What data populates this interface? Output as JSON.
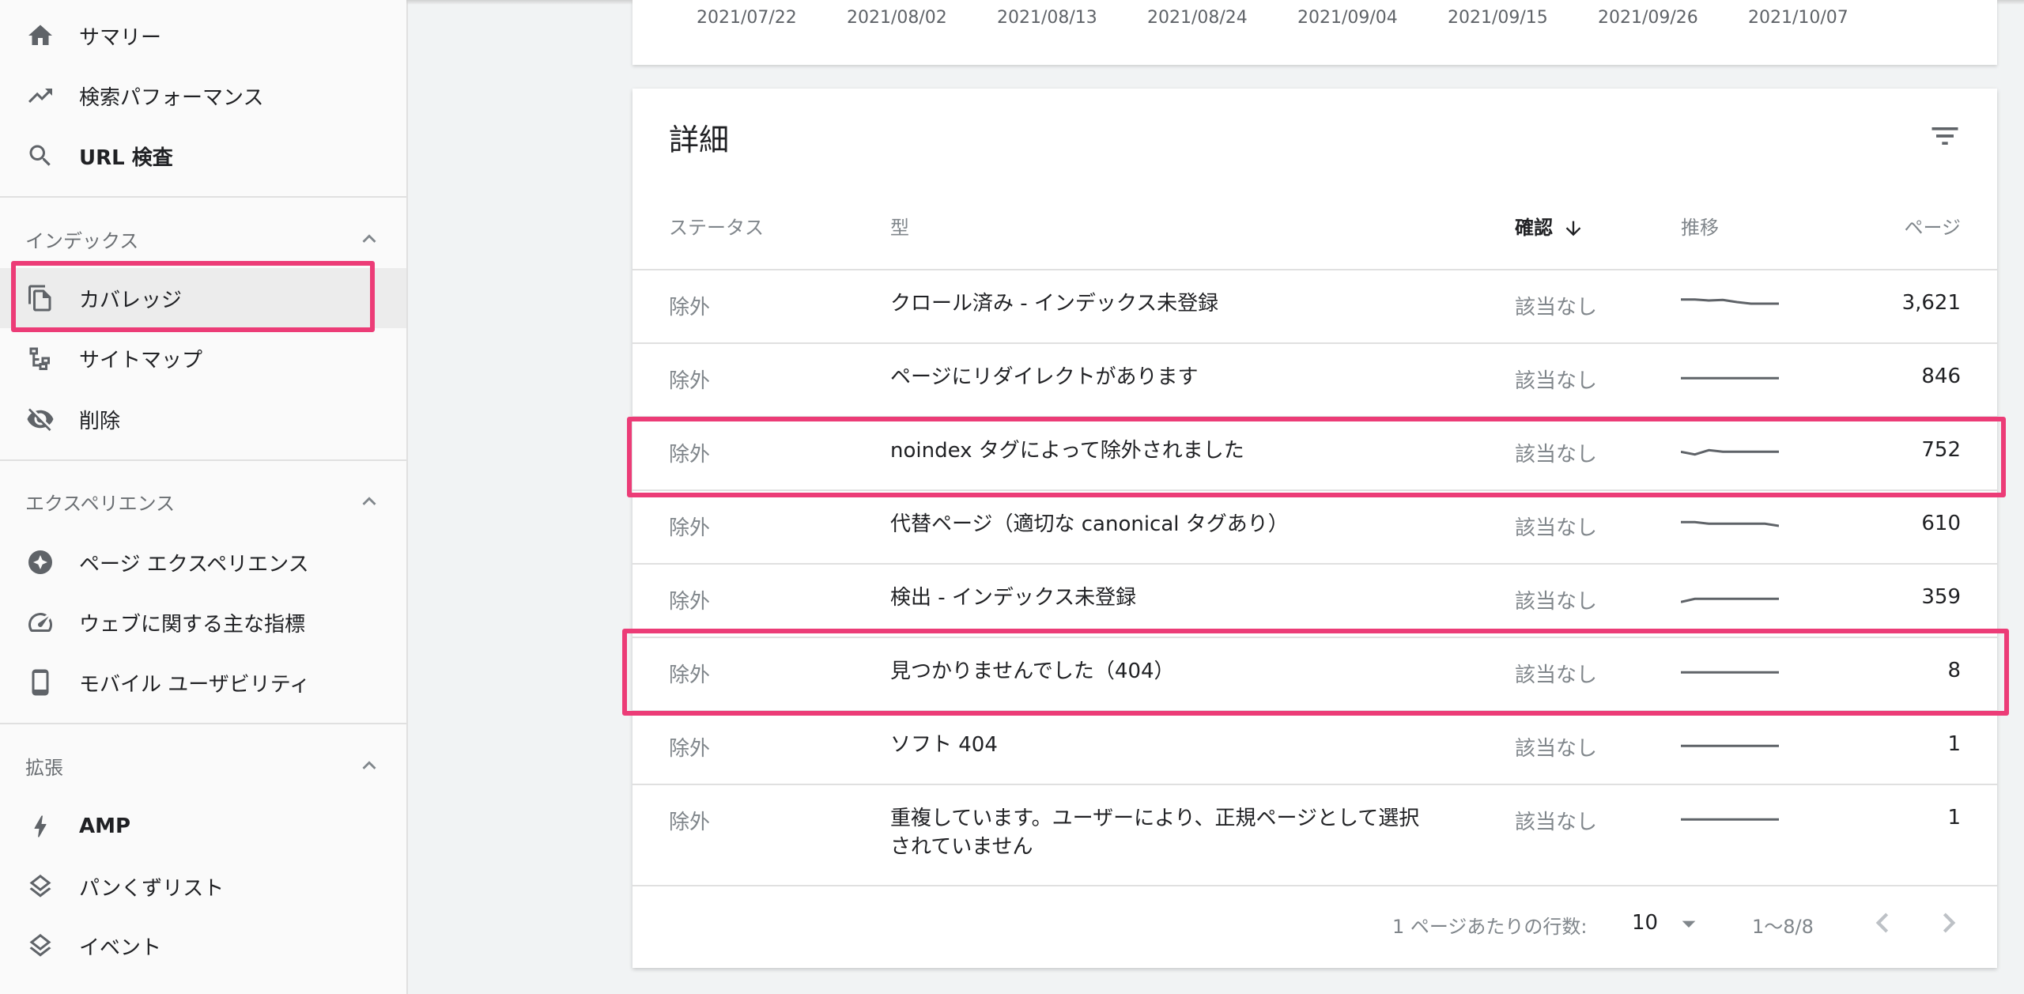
{
  "sidebar": {
    "top_items": [
      {
        "label": "サマリー",
        "icon": "home-icon"
      },
      {
        "label": "検索パフォーマンス",
        "icon": "trending-up-icon"
      },
      {
        "label": "URL 検査",
        "icon": "search-icon"
      }
    ],
    "sections": [
      {
        "label": "インデックス",
        "items": [
          {
            "label": "カバレッジ",
            "icon": "file-copy-icon",
            "active": true
          },
          {
            "label": "サイトマップ",
            "icon": "sitemap-icon"
          },
          {
            "label": "削除",
            "icon": "visibility-off-icon"
          }
        ]
      },
      {
        "label": "エクスペリエンス",
        "items": [
          {
            "label": "ページ エクスペリエンス",
            "icon": "page-experience-icon"
          },
          {
            "label": "ウェブに関する主な指標",
            "icon": "speed-gauge-icon"
          },
          {
            "label": "モバイル ユーザビリティ",
            "icon": "smartphone-icon"
          }
        ]
      },
      {
        "label": "拡張",
        "items": [
          {
            "label": "AMP",
            "icon": "bolt-icon"
          },
          {
            "label": "パンくずリスト",
            "icon": "layers-icon"
          },
          {
            "label": "イベント",
            "icon": "layers-icon"
          }
        ]
      }
    ]
  },
  "chart_axis": {
    "dates": [
      "2021/07/22",
      "2021/08/02",
      "2021/08/13",
      "2021/08/24",
      "2021/09/04",
      "2021/09/15",
      "2021/09/26",
      "2021/10/07"
    ]
  },
  "details": {
    "title": "詳細",
    "columns": {
      "status": "ステータス",
      "type": "型",
      "confirm": "確認",
      "trend": "推移",
      "pages": "ページ"
    },
    "rows": [
      {
        "status": "除外",
        "type": "クロール済み - インデックス未登録",
        "confirm": "該当なし",
        "pages": "3,621",
        "trend": [
          2,
          2,
          1.8,
          1.9,
          1.5,
          1.2,
          1.2,
          1.2
        ]
      },
      {
        "status": "除外",
        "type": "ページにリダイレクトがあります",
        "confirm": "該当なし",
        "pages": "846",
        "trend": [
          1,
          1,
          1,
          1,
          1,
          1,
          1,
          1
        ]
      },
      {
        "status": "除外",
        "type": "noindex タグによって除外されました",
        "confirm": "該当なし",
        "pages": "752",
        "trend": [
          1,
          0.5,
          1.3,
          1,
          1,
          1,
          1,
          1
        ]
      },
      {
        "status": "除外",
        "type": "代替ページ（適切な canonical タグあり）",
        "confirm": "該当なし",
        "pages": "610",
        "trend": [
          1.6,
          1.6,
          1.3,
          1.3,
          1.3,
          1.3,
          1.3,
          0.9
        ]
      },
      {
        "status": "除外",
        "type": "検出 - インデックス未登録",
        "confirm": "該当なし",
        "pages": "359",
        "trend": [
          0.4,
          1,
          1,
          1,
          1,
          1,
          1,
          1
        ]
      },
      {
        "status": "除外",
        "type": "見つかりませんでした（404）",
        "confirm": "該当なし",
        "pages": "8",
        "trend": [
          1,
          1,
          1,
          1,
          1,
          1,
          1,
          1
        ]
      },
      {
        "status": "除外",
        "type": "ソフト 404",
        "confirm": "該当なし",
        "pages": "1",
        "trend": [
          1,
          1,
          1,
          1,
          1,
          1,
          1,
          1
        ]
      },
      {
        "status": "除外",
        "type_line1": "重複しています。ユーザーにより、正規ページとして選択",
        "type_line2": "されていません",
        "confirm": "該当なし",
        "pages": "1",
        "trend": [
          1,
          1,
          1,
          1,
          1,
          1,
          1,
          1
        ]
      }
    ],
    "footer": {
      "rows_per_page_label": "1 ページあたりの行数:",
      "rows_per_page_value": "10",
      "range": "1〜8/8"
    }
  },
  "colors": {
    "highlight": "#ec3c77",
    "sparkline": "#5f6368"
  }
}
